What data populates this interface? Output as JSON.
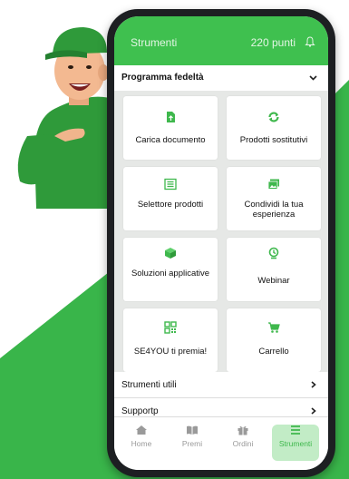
{
  "colors": {
    "brand_green": "#3fc04f",
    "bg_green": "#39b54a",
    "mascot_cap": "#2f9a3a"
  },
  "header": {
    "title": "Strumenti",
    "points": "220 punti",
    "bell_icon": "bell-icon"
  },
  "program_select": {
    "value": "Programma fedeltà",
    "icon": "chevron-down-icon"
  },
  "tiles": [
    {
      "label": "Carica documento",
      "icon": "document-upload-icon"
    },
    {
      "label": "Prodotti sostitutivi",
      "icon": "refresh-icon"
    },
    {
      "label": "Selettore prodotti",
      "icon": "list-icon"
    },
    {
      "label": "Condividi la tua esperienza",
      "icon": "gallery-icon"
    },
    {
      "label": "Soluzioni applicative",
      "icon": "cube-icon"
    },
    {
      "label": "Webinar",
      "icon": "webinar-icon"
    },
    {
      "label": "SE4YOU ti premia!",
      "icon": "qr-code-icon"
    },
    {
      "label": "Carrello",
      "icon": "cart-icon"
    }
  ],
  "rows": [
    {
      "label": "Strumenti utili",
      "icon": "chevron-right-icon"
    },
    {
      "label": "Supportp",
      "icon": "chevron-right-icon"
    }
  ],
  "nav": [
    {
      "label": "Home",
      "icon": "home-icon",
      "active": false
    },
    {
      "label": "Premi",
      "icon": "book-icon",
      "active": false
    },
    {
      "label": "Ordini",
      "icon": "gift-icon",
      "active": false
    },
    {
      "label": "Strumenti",
      "icon": "menu-icon",
      "active": true
    }
  ]
}
